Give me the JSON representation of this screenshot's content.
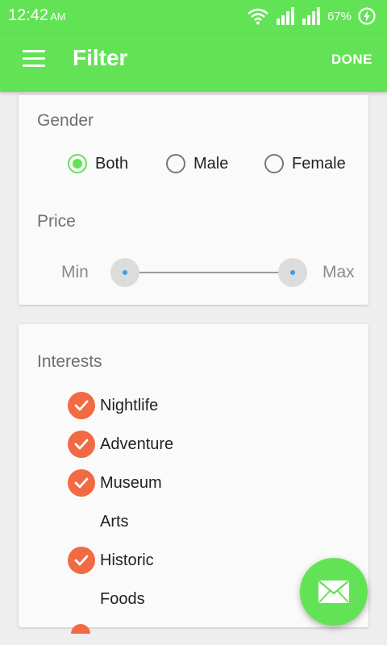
{
  "status_bar": {
    "time": "12:42",
    "ampm": "AM",
    "battery_percent": "67%",
    "icons": [
      "wifi-icon",
      "signal-icon",
      "signal-icon",
      "battery-charging-icon"
    ]
  },
  "toolbar": {
    "title": "Filter",
    "done_label": "DONE",
    "menu_icon": "hamburger-menu-icon"
  },
  "gender": {
    "label": "Gender",
    "options": [
      {
        "label": "Both",
        "selected": true
      },
      {
        "label": "Male",
        "selected": false
      },
      {
        "label": "Female",
        "selected": false
      }
    ]
  },
  "price": {
    "label": "Price",
    "min_label": "Min",
    "max_label": "Max"
  },
  "interests": {
    "label": "Interests",
    "items": [
      {
        "label": "Nightlife",
        "checked": true
      },
      {
        "label": "Adventure",
        "checked": true
      },
      {
        "label": "Museum",
        "checked": true
      },
      {
        "label": "Arts",
        "checked": false
      },
      {
        "label": "Historic",
        "checked": true
      },
      {
        "label": "Foods",
        "checked": false
      }
    ]
  },
  "fab": {
    "icon": "mail-icon"
  },
  "colors": {
    "primary": "#62e355",
    "checkbox": "#f26a43",
    "slider_dot": "#3ea0e0"
  }
}
